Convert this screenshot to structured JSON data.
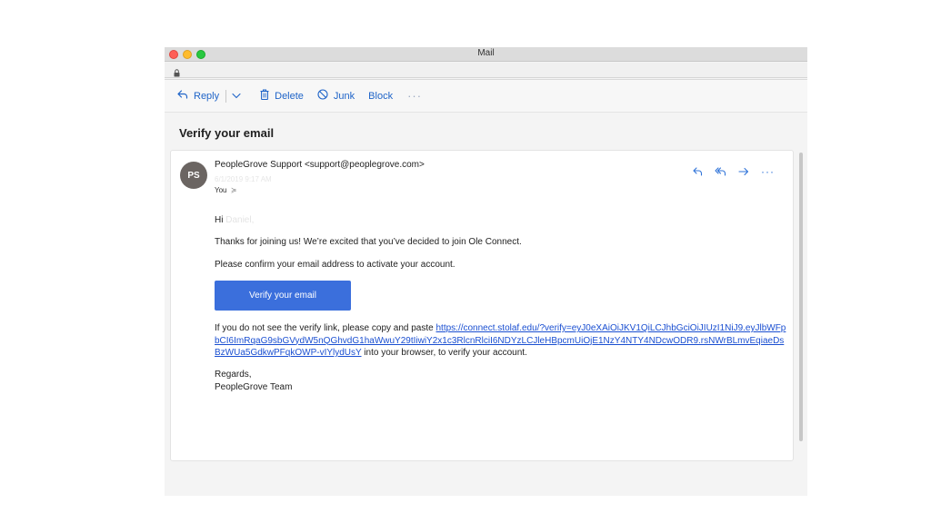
{
  "window": {
    "title": "Mail"
  },
  "toolbar": {
    "reply_label": "Reply",
    "delete_label": "Delete",
    "junk_label": "Junk",
    "block_label": "Block",
    "more_label": "···"
  },
  "message": {
    "subject": "Verify your email",
    "avatar_initials": "PS",
    "sender": "PeopleGrove Support <support@peoplegrove.com>",
    "date": "6/1/2019 9:17 AM",
    "to_label": "You",
    "to_chevron": "≽",
    "actions_more": "···",
    "greeting_prefix": "Hi",
    "greeting_name": "Daniel,",
    "para1": "Thanks for joining us! We’re excited that you’ve decided to join Ole Connect.",
    "para2": "Please confirm your email address to activate your account.",
    "button_label": "Verify your email",
    "para3_prefix": "If you do not see the verify link, please copy and paste ",
    "verify_link": "https://connect.stolaf.edu/?verify=eyJ0eXAiOiJKV1QiLCJhbGciOiJIUzI1NiJ9.eyJlbWFpbCI6ImRqaG9sbGVydW5nQGhvdG1haWwuY29tIiwiY2x1c3RlcnRlciI6NDYzLCJleHBpcmUiOjE1NzY4NTY4NDcwODR9.rsNWrBLmvEqiaeDsBzWUa5GdkwPFqkOWP-vIYlydUsY",
    "para3_suffix": " into your browser, to verify your account.",
    "regards": "Regards,",
    "signature": "PeopleGrove Team"
  },
  "colors": {
    "accent": "#1f64c8",
    "button": "#3b6fdc",
    "avatar": "#6b6562"
  }
}
